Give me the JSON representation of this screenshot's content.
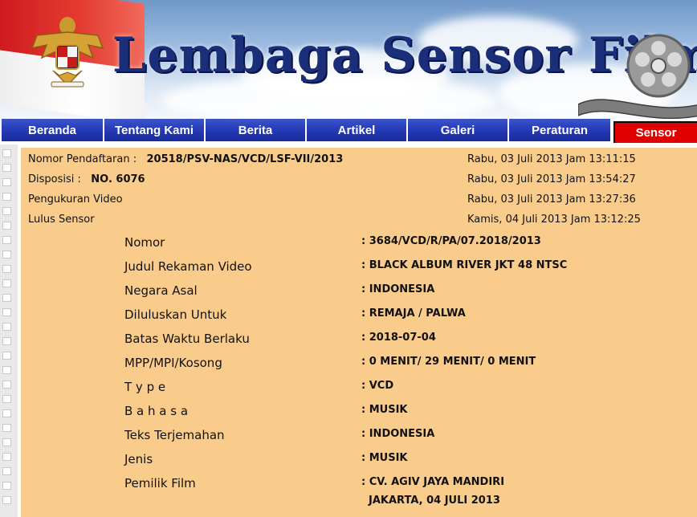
{
  "header": {
    "site_title": "Lembaga Sensor Film"
  },
  "nav": {
    "items": [
      "Beranda",
      "Tentang Kami",
      "Berita",
      "Artikel",
      "Galeri",
      "Peraturan",
      "Sensor"
    ],
    "active": "Sensor"
  },
  "meta": {
    "registration_label": "Nomor Pendaftaran :",
    "registration_value": "20518/PSV-NAS/VCD/LSF-VII/2013",
    "registration_date": "Rabu, 03 Juli 2013 Jam 13:11:15",
    "disposition_label": "Disposisi :",
    "disposition_value": "NO. 6076",
    "disposition_date": "Rabu, 03 Juli 2013 Jam 13:54:27",
    "measurement_label": "Pengukuran Video",
    "measurement_date": "Rabu, 03 Juli 2013 Jam 13:27:36",
    "passed_label": "Lulus Sensor",
    "passed_date": "Kamis, 04 Juli 2013 Jam 13:12:25"
  },
  "details": [
    {
      "label": "Nomor",
      "value": ": 3684/VCD/R/PA/07.2018/2013"
    },
    {
      "label": "Judul Rekaman Video",
      "value": ": BLACK ALBUM RIVER JKT 48 NTSC"
    },
    {
      "label": "Negara Asal",
      "value": ": INDONESIA"
    },
    {
      "label": "Diluluskan Untuk",
      "value": ": REMAJA / PALWA"
    },
    {
      "label": "Batas Waktu Berlaku",
      "value": ": 2018-07-04"
    },
    {
      "label": "MPP/MPI/Kosong",
      "value": ": 0 MENIT/ 29 MENIT/ 0 MENIT"
    },
    {
      "label": "T y p e",
      "value": ": VCD"
    },
    {
      "label": "B a h a s a",
      "value": ": MUSIK"
    },
    {
      "label": "Teks Terjemahan",
      "value": ": INDONESIA"
    },
    {
      "label": "Jenis",
      "value": ": MUSIK"
    },
    {
      "label": "Pemilik Film",
      "value": ": CV. AGIV JAYA MANDIRI"
    }
  ],
  "footer_line": "JAKARTA, 04 JULI 2013",
  "colors": {
    "nav_blue": "#2238b5",
    "nav_active": "#e10000",
    "panel": "#f9cc8c",
    "title": "#1a2e7a"
  }
}
